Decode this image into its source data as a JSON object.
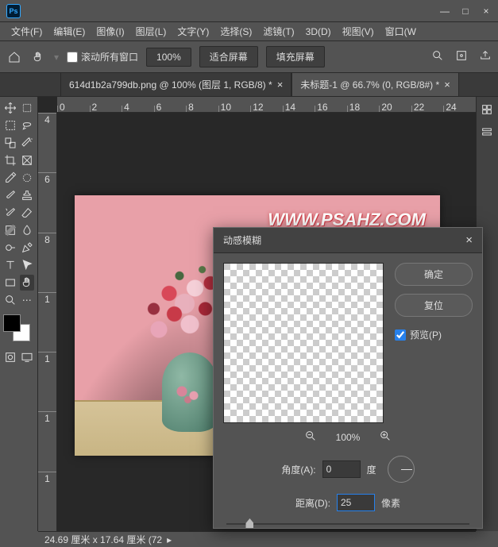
{
  "titlebar": {
    "min": "—",
    "max": "□",
    "close": "×"
  },
  "menu": [
    "文件(F)",
    "编辑(E)",
    "图像(I)",
    "图层(L)",
    "文字(Y)",
    "选择(S)",
    "滤镜(T)",
    "3D(D)",
    "视图(V)",
    "窗口(W"
  ],
  "options": {
    "scroll_all": "滚动所有窗口",
    "zoom": "100%",
    "fit": "适合屏幕",
    "fill": "填充屏幕"
  },
  "tabs": [
    {
      "label": "614d1b2a799db.png @ 100% (图层 1, RGB/8) *",
      "active": false
    },
    {
      "label": "未标题-1 @ 66.7% (0, RGB/8#) *",
      "active": true
    }
  ],
  "ruler_h": [
    "0",
    "2",
    "4",
    "6",
    "8",
    "10",
    "12",
    "14",
    "16",
    "18",
    "20",
    "22",
    "24"
  ],
  "ruler_v": [
    "4",
    "6",
    "8",
    "1",
    "1",
    "1",
    "1"
  ],
  "canvas": {
    "watermark": "WWW.PSAHZ.COM"
  },
  "status": {
    "text": "24.69 厘米 x 17.64 厘米 (72"
  },
  "dialog": {
    "title": "动感模糊",
    "ok": "确定",
    "reset": "复位",
    "preview": "预览(P)",
    "preview_checked": true,
    "zoom": "100%",
    "angle_label": "角度(A):",
    "angle_value": "0",
    "angle_unit": "度",
    "distance_label": "距离(D):",
    "distance_value": "25",
    "distance_unit": "像素"
  }
}
